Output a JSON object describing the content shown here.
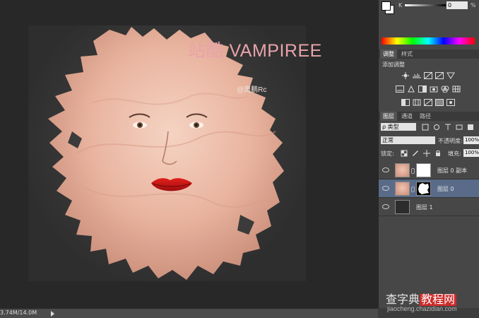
{
  "canvas": {
    "title": "站酷 VAMPIREE",
    "subtitle": "@周鹏Rc"
  },
  "status_bar": {
    "doc_size": "3.74M/14.0M"
  },
  "watermark": {
    "text_a": "查字典",
    "text_b": "教程网",
    "url": "jiaocheng.chazidian.com"
  },
  "color_panel": {
    "k_label": "K",
    "k_value": "0",
    "k_unit": "%",
    "foreground": "#ffffff",
    "background": "#ffffff"
  },
  "adjustments": {
    "tabs": [
      {
        "label": "调整",
        "active": true
      },
      {
        "label": "样式",
        "active": false
      }
    ],
    "title": "添加调整"
  },
  "layers": {
    "tabs": [
      {
        "label": "图层",
        "active": true
      },
      {
        "label": "通道",
        "active": false
      },
      {
        "label": "路径",
        "active": false
      }
    ],
    "filter": "ρ 类型",
    "blend_mode": "正常",
    "opacity_label": "不透明度:",
    "opacity": "100%",
    "lock_label": "锁定:",
    "fill_label": "填充:",
    "fill": "100%",
    "items": [
      {
        "name": "图层 0 副本",
        "selected": false
      },
      {
        "name": "图层 0",
        "selected": true
      },
      {
        "name": "图层 1",
        "selected": false
      }
    ]
  }
}
